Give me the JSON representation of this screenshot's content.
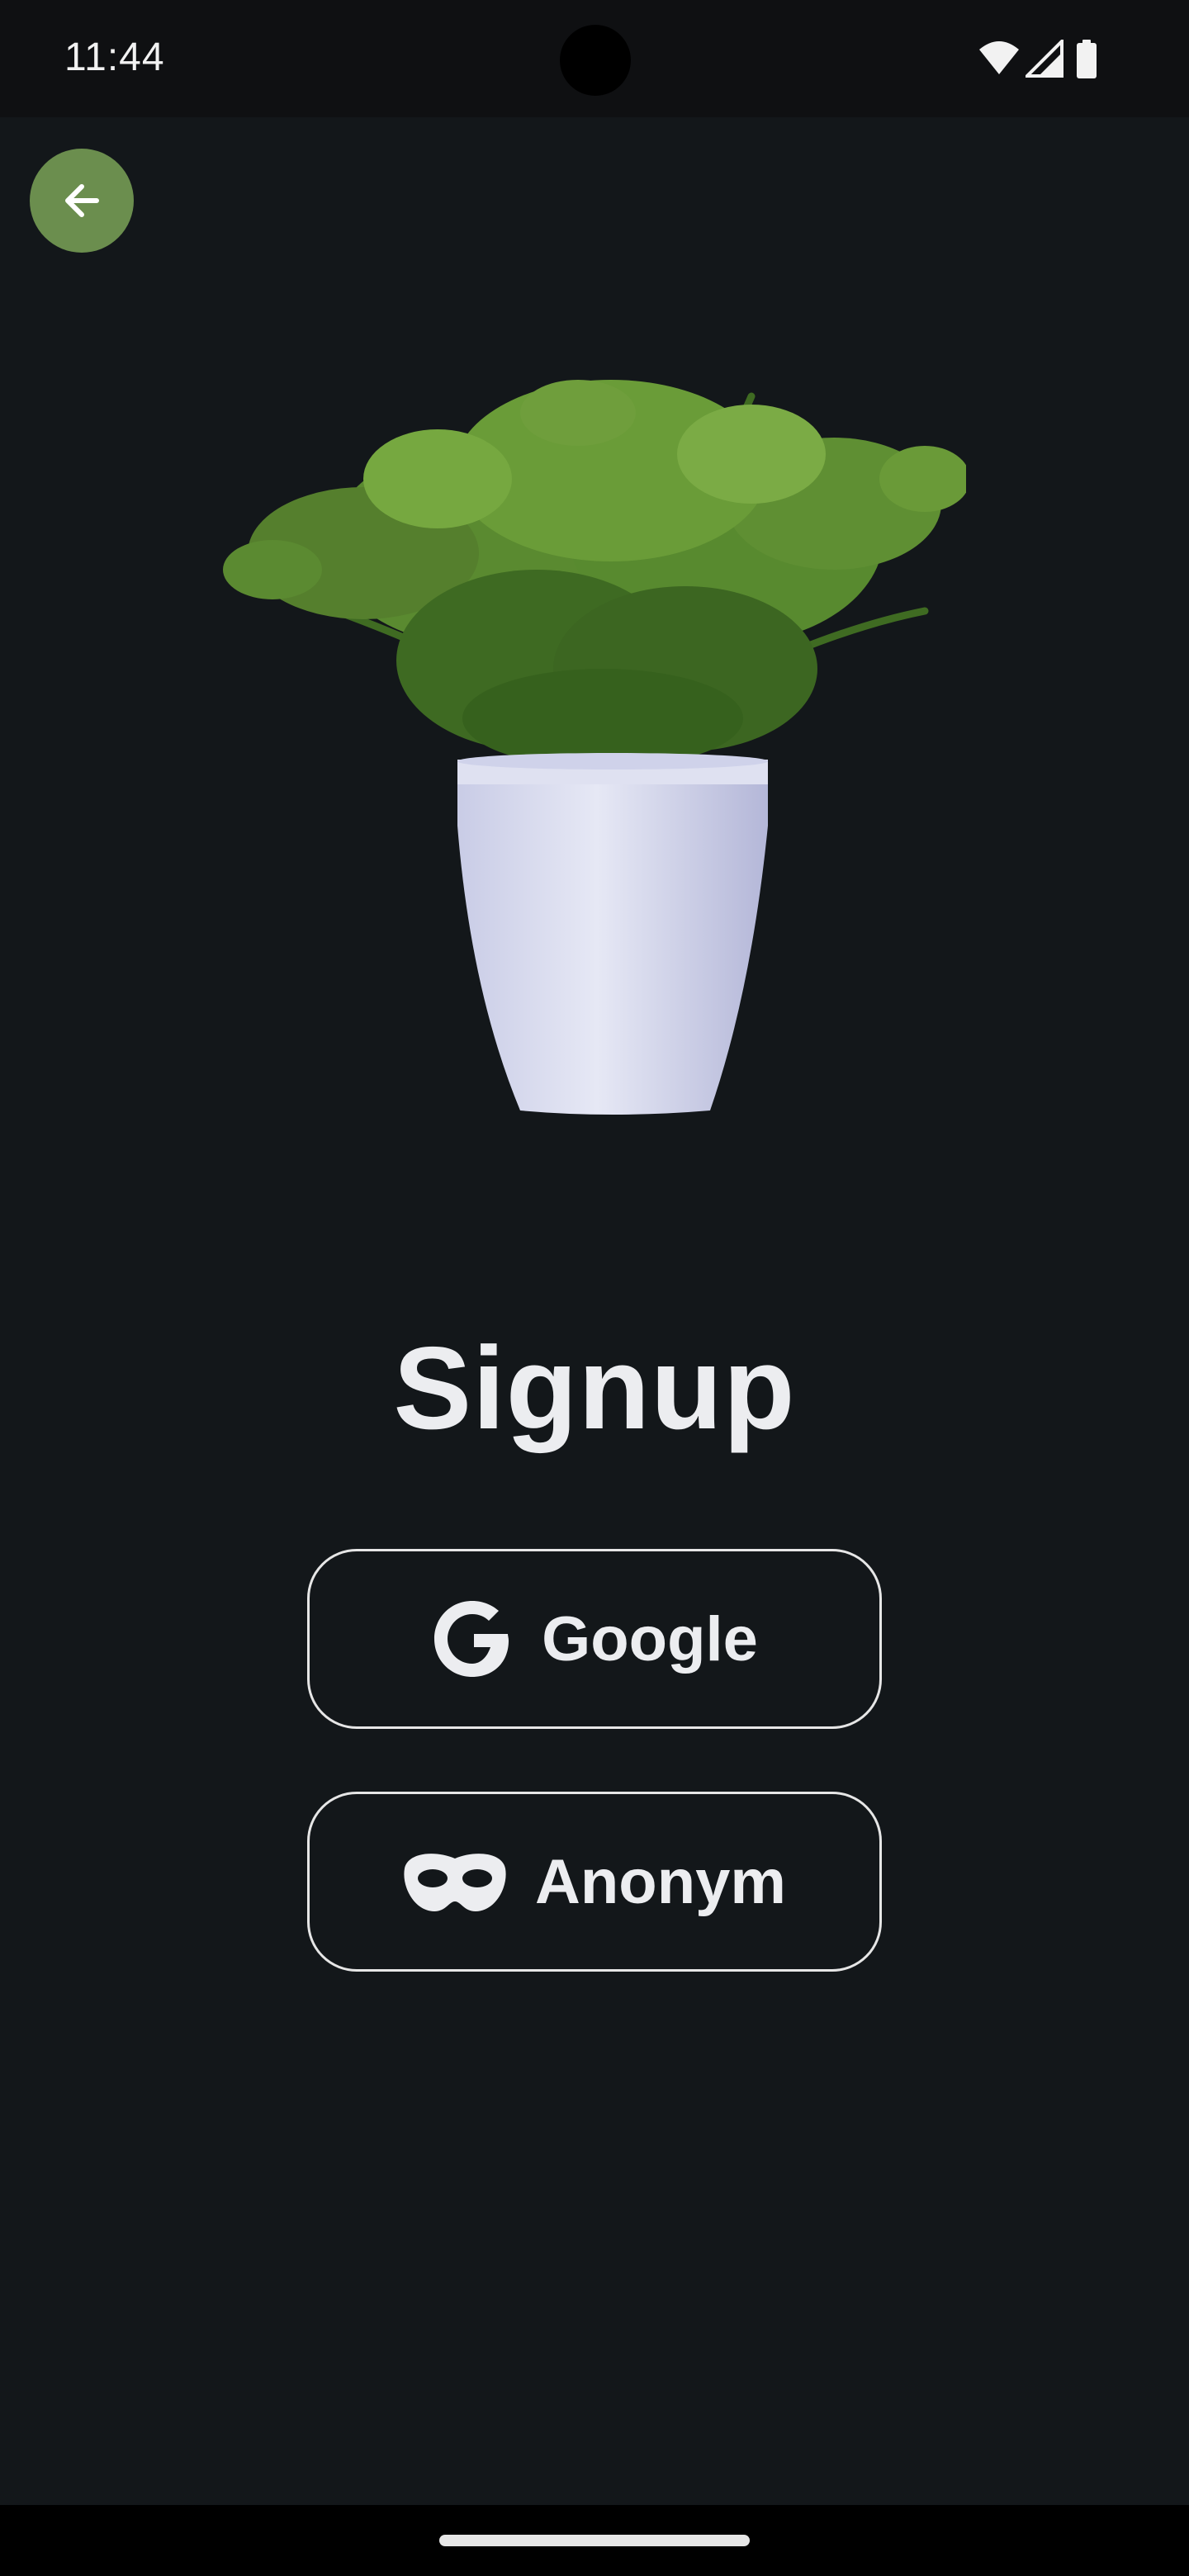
{
  "status_bar": {
    "time": "11:44",
    "icons": [
      "wifi-icon",
      "cellular-signal-icon",
      "battery-icon"
    ]
  },
  "header": {
    "back_icon": "arrow-left-icon",
    "back_button_color": "#6b8e4e"
  },
  "hero": {
    "image": "potted-plant-image"
  },
  "main": {
    "title": "Signup",
    "buttons": [
      {
        "label": "Google",
        "icon": "google-icon"
      },
      {
        "label": "Anonym",
        "icon": "mask-icon"
      }
    ]
  },
  "theme": {
    "background": "#13171a",
    "text": "#ecedf0",
    "accent": "#6b8e4e"
  }
}
